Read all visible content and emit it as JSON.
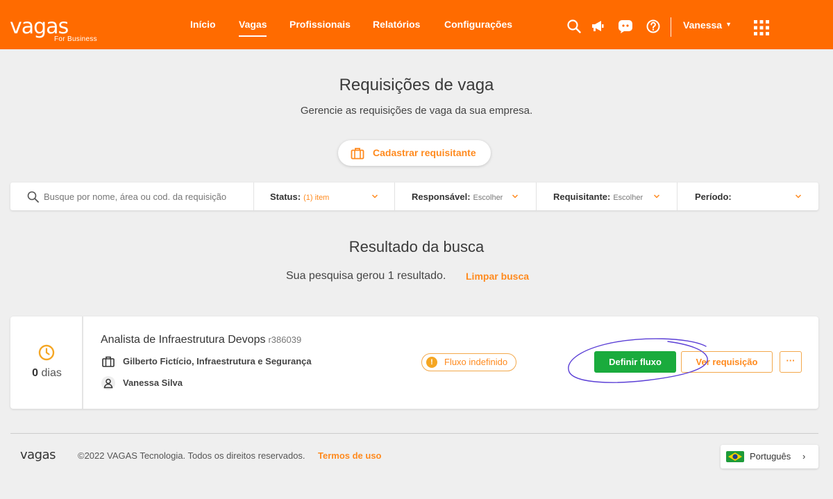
{
  "header": {
    "logo": "vagas",
    "logo_sub": "For Business",
    "nav": [
      "Início",
      "Vagas",
      "Profissionais",
      "Relatórios",
      "Configurações"
    ],
    "active_nav": "Vagas",
    "icons": [
      "search-icon",
      "megaphone-icon",
      "chat-icon",
      "help-icon",
      "apps-grid-icon"
    ],
    "user_name": "Vanessa",
    "brand_color": "#ff6b00"
  },
  "page": {
    "title": "Requisições de vaga",
    "subtitle": "Gerencie as requisições de vaga da sua empresa.",
    "register_button": "Cadastrar requisitante"
  },
  "filters": {
    "search_placeholder": "Busque por nome, área ou cod. da requisição",
    "search_value": "",
    "status_label": "Status:",
    "status_value": "(1) item",
    "responsavel_label": "Responsável:",
    "responsavel_value": "Escolher",
    "requisitante_label": "Requisitante:",
    "requisitante_value": "Escolher",
    "periodo_label": "Período:"
  },
  "results": {
    "title": "Resultado da busca",
    "summary": "Sua pesquisa gerou 1 resultado.",
    "clear_link": "Limpar busca"
  },
  "card": {
    "days_number": "0",
    "days_unit": "dias",
    "job_title": "Analista de Infraestrutura Devops",
    "job_code": "r386039",
    "department": "Gilberto Fictício, Infraestrutura e Segurança",
    "owner": "Vanessa Silva",
    "status": "Fluxo indefinido",
    "define_button": "Definir fluxo",
    "view_button": "Ver requisição",
    "more_button": "···",
    "accent_green": "#1aab3d",
    "accent_orange": "#ff8a1e"
  },
  "footer": {
    "logo": "vagas",
    "copyright": "©2022 VAGAS Tecnologia. Todos os direitos reservados.",
    "terms": "Termos de uso",
    "language": "Português"
  }
}
